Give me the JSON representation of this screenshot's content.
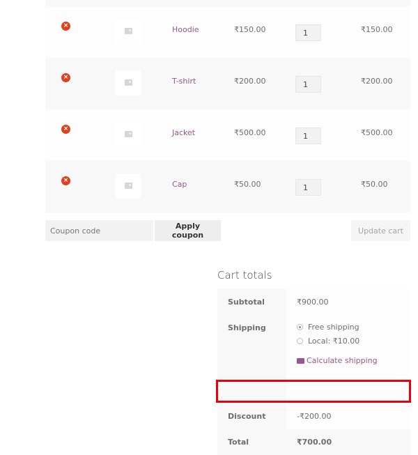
{
  "cart": {
    "items": [
      {
        "name": "Hoodie",
        "price": "₹150.00",
        "quantity": "1",
        "subtotal": "₹150.00"
      },
      {
        "name": "T-shirt",
        "price": "₹200.00",
        "quantity": "1",
        "subtotal": "₹200.00"
      },
      {
        "name": "Jacket",
        "price": "₹500.00",
        "quantity": "1",
        "subtotal": "₹500.00"
      },
      {
        "name": "Cap",
        "price": "₹50.00",
        "quantity": "1",
        "subtotal": "₹50.00"
      }
    ],
    "remove_icon": "×"
  },
  "actions": {
    "coupon_placeholder": "Coupon code",
    "apply_coupon_label": "Apply coupon",
    "update_cart_label": "Update cart"
  },
  "totals": {
    "title": "Cart totals",
    "subtotal_label": "Subtotal",
    "subtotal_value": "₹900.00",
    "shipping_label": "Shipping",
    "shipping_options": [
      {
        "label": "Free shipping",
        "selected": true
      },
      {
        "label": "Local: ₹10.00",
        "selected": false
      }
    ],
    "calculate_shipping_label": "Calculate shipping",
    "discount_label": "Discount",
    "discount_value": "-₹200.00",
    "total_label": "Total",
    "total_value": "₹700.00"
  },
  "colors": {
    "link": "#96588a",
    "remove": "#e2401c",
    "highlight": "#e8000b"
  }
}
